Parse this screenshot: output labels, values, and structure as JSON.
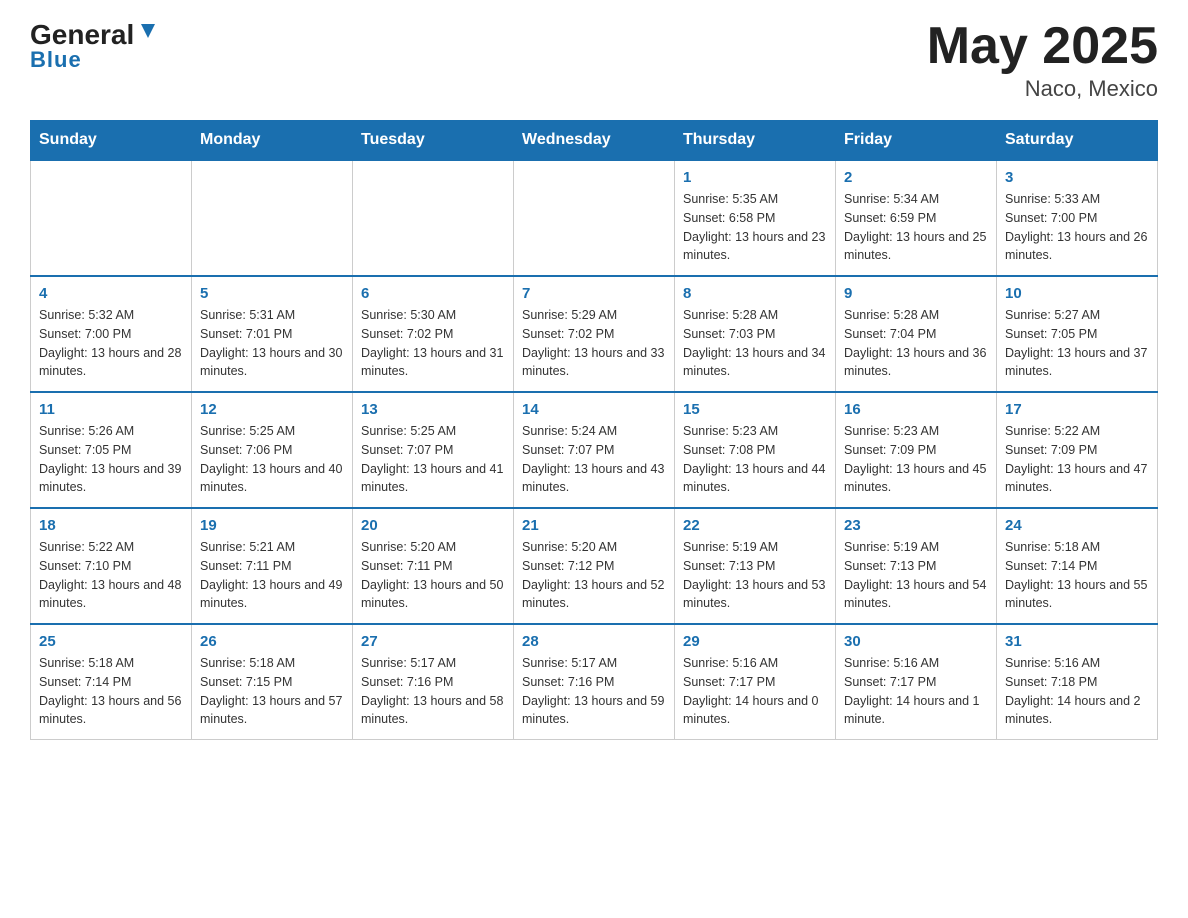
{
  "header": {
    "logo_line1": "General",
    "logo_line2": "Blue",
    "title": "May 2025",
    "subtitle": "Naco, Mexico"
  },
  "calendar": {
    "days_of_week": [
      "Sunday",
      "Monday",
      "Tuesday",
      "Wednesday",
      "Thursday",
      "Friday",
      "Saturday"
    ],
    "weeks": [
      [
        {
          "day": "",
          "info": ""
        },
        {
          "day": "",
          "info": ""
        },
        {
          "day": "",
          "info": ""
        },
        {
          "day": "",
          "info": ""
        },
        {
          "day": "1",
          "info": "Sunrise: 5:35 AM\nSunset: 6:58 PM\nDaylight: 13 hours and 23 minutes."
        },
        {
          "day": "2",
          "info": "Sunrise: 5:34 AM\nSunset: 6:59 PM\nDaylight: 13 hours and 25 minutes."
        },
        {
          "day": "3",
          "info": "Sunrise: 5:33 AM\nSunset: 7:00 PM\nDaylight: 13 hours and 26 minutes."
        }
      ],
      [
        {
          "day": "4",
          "info": "Sunrise: 5:32 AM\nSunset: 7:00 PM\nDaylight: 13 hours and 28 minutes."
        },
        {
          "day": "5",
          "info": "Sunrise: 5:31 AM\nSunset: 7:01 PM\nDaylight: 13 hours and 30 minutes."
        },
        {
          "day": "6",
          "info": "Sunrise: 5:30 AM\nSunset: 7:02 PM\nDaylight: 13 hours and 31 minutes."
        },
        {
          "day": "7",
          "info": "Sunrise: 5:29 AM\nSunset: 7:02 PM\nDaylight: 13 hours and 33 minutes."
        },
        {
          "day": "8",
          "info": "Sunrise: 5:28 AM\nSunset: 7:03 PM\nDaylight: 13 hours and 34 minutes."
        },
        {
          "day": "9",
          "info": "Sunrise: 5:28 AM\nSunset: 7:04 PM\nDaylight: 13 hours and 36 minutes."
        },
        {
          "day": "10",
          "info": "Sunrise: 5:27 AM\nSunset: 7:05 PM\nDaylight: 13 hours and 37 minutes."
        }
      ],
      [
        {
          "day": "11",
          "info": "Sunrise: 5:26 AM\nSunset: 7:05 PM\nDaylight: 13 hours and 39 minutes."
        },
        {
          "day": "12",
          "info": "Sunrise: 5:25 AM\nSunset: 7:06 PM\nDaylight: 13 hours and 40 minutes."
        },
        {
          "day": "13",
          "info": "Sunrise: 5:25 AM\nSunset: 7:07 PM\nDaylight: 13 hours and 41 minutes."
        },
        {
          "day": "14",
          "info": "Sunrise: 5:24 AM\nSunset: 7:07 PM\nDaylight: 13 hours and 43 minutes."
        },
        {
          "day": "15",
          "info": "Sunrise: 5:23 AM\nSunset: 7:08 PM\nDaylight: 13 hours and 44 minutes."
        },
        {
          "day": "16",
          "info": "Sunrise: 5:23 AM\nSunset: 7:09 PM\nDaylight: 13 hours and 45 minutes."
        },
        {
          "day": "17",
          "info": "Sunrise: 5:22 AM\nSunset: 7:09 PM\nDaylight: 13 hours and 47 minutes."
        }
      ],
      [
        {
          "day": "18",
          "info": "Sunrise: 5:22 AM\nSunset: 7:10 PM\nDaylight: 13 hours and 48 minutes."
        },
        {
          "day": "19",
          "info": "Sunrise: 5:21 AM\nSunset: 7:11 PM\nDaylight: 13 hours and 49 minutes."
        },
        {
          "day": "20",
          "info": "Sunrise: 5:20 AM\nSunset: 7:11 PM\nDaylight: 13 hours and 50 minutes."
        },
        {
          "day": "21",
          "info": "Sunrise: 5:20 AM\nSunset: 7:12 PM\nDaylight: 13 hours and 52 minutes."
        },
        {
          "day": "22",
          "info": "Sunrise: 5:19 AM\nSunset: 7:13 PM\nDaylight: 13 hours and 53 minutes."
        },
        {
          "day": "23",
          "info": "Sunrise: 5:19 AM\nSunset: 7:13 PM\nDaylight: 13 hours and 54 minutes."
        },
        {
          "day": "24",
          "info": "Sunrise: 5:18 AM\nSunset: 7:14 PM\nDaylight: 13 hours and 55 minutes."
        }
      ],
      [
        {
          "day": "25",
          "info": "Sunrise: 5:18 AM\nSunset: 7:14 PM\nDaylight: 13 hours and 56 minutes."
        },
        {
          "day": "26",
          "info": "Sunrise: 5:18 AM\nSunset: 7:15 PM\nDaylight: 13 hours and 57 minutes."
        },
        {
          "day": "27",
          "info": "Sunrise: 5:17 AM\nSunset: 7:16 PM\nDaylight: 13 hours and 58 minutes."
        },
        {
          "day": "28",
          "info": "Sunrise: 5:17 AM\nSunset: 7:16 PM\nDaylight: 13 hours and 59 minutes."
        },
        {
          "day": "29",
          "info": "Sunrise: 5:16 AM\nSunset: 7:17 PM\nDaylight: 14 hours and 0 minutes."
        },
        {
          "day": "30",
          "info": "Sunrise: 5:16 AM\nSunset: 7:17 PM\nDaylight: 14 hours and 1 minute."
        },
        {
          "day": "31",
          "info": "Sunrise: 5:16 AM\nSunset: 7:18 PM\nDaylight: 14 hours and 2 minutes."
        }
      ]
    ]
  }
}
